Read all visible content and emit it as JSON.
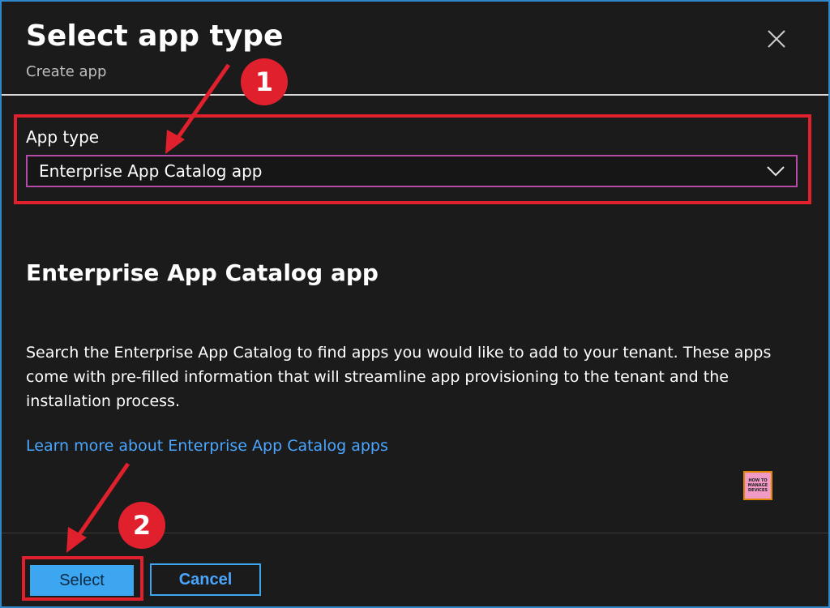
{
  "dialog": {
    "title": "Select app type",
    "subtitle": "Create app"
  },
  "field": {
    "label": "App type",
    "selected_value": "Enterprise App Catalog app"
  },
  "content": {
    "heading": "Enterprise App Catalog app",
    "description": "Search the Enterprise App Catalog to find apps you would like to add to your tenant. These apps come with pre-filled information that will streamline app provisioning to the tenant and the installation process.",
    "learn_more_link": "Learn more about Enterprise App Catalog apps"
  },
  "watermark": {
    "text": "HOW TO MANAGE DEVICES"
  },
  "footer": {
    "select_label": "Select",
    "cancel_label": "Cancel"
  },
  "annotations": {
    "step1": "1",
    "step2": "2",
    "color": "#e0202d"
  },
  "colors": {
    "accent": "#3da6f0",
    "link": "#4aa6ff",
    "background": "#1b1b1b",
    "select_border": "#b54aa8"
  }
}
